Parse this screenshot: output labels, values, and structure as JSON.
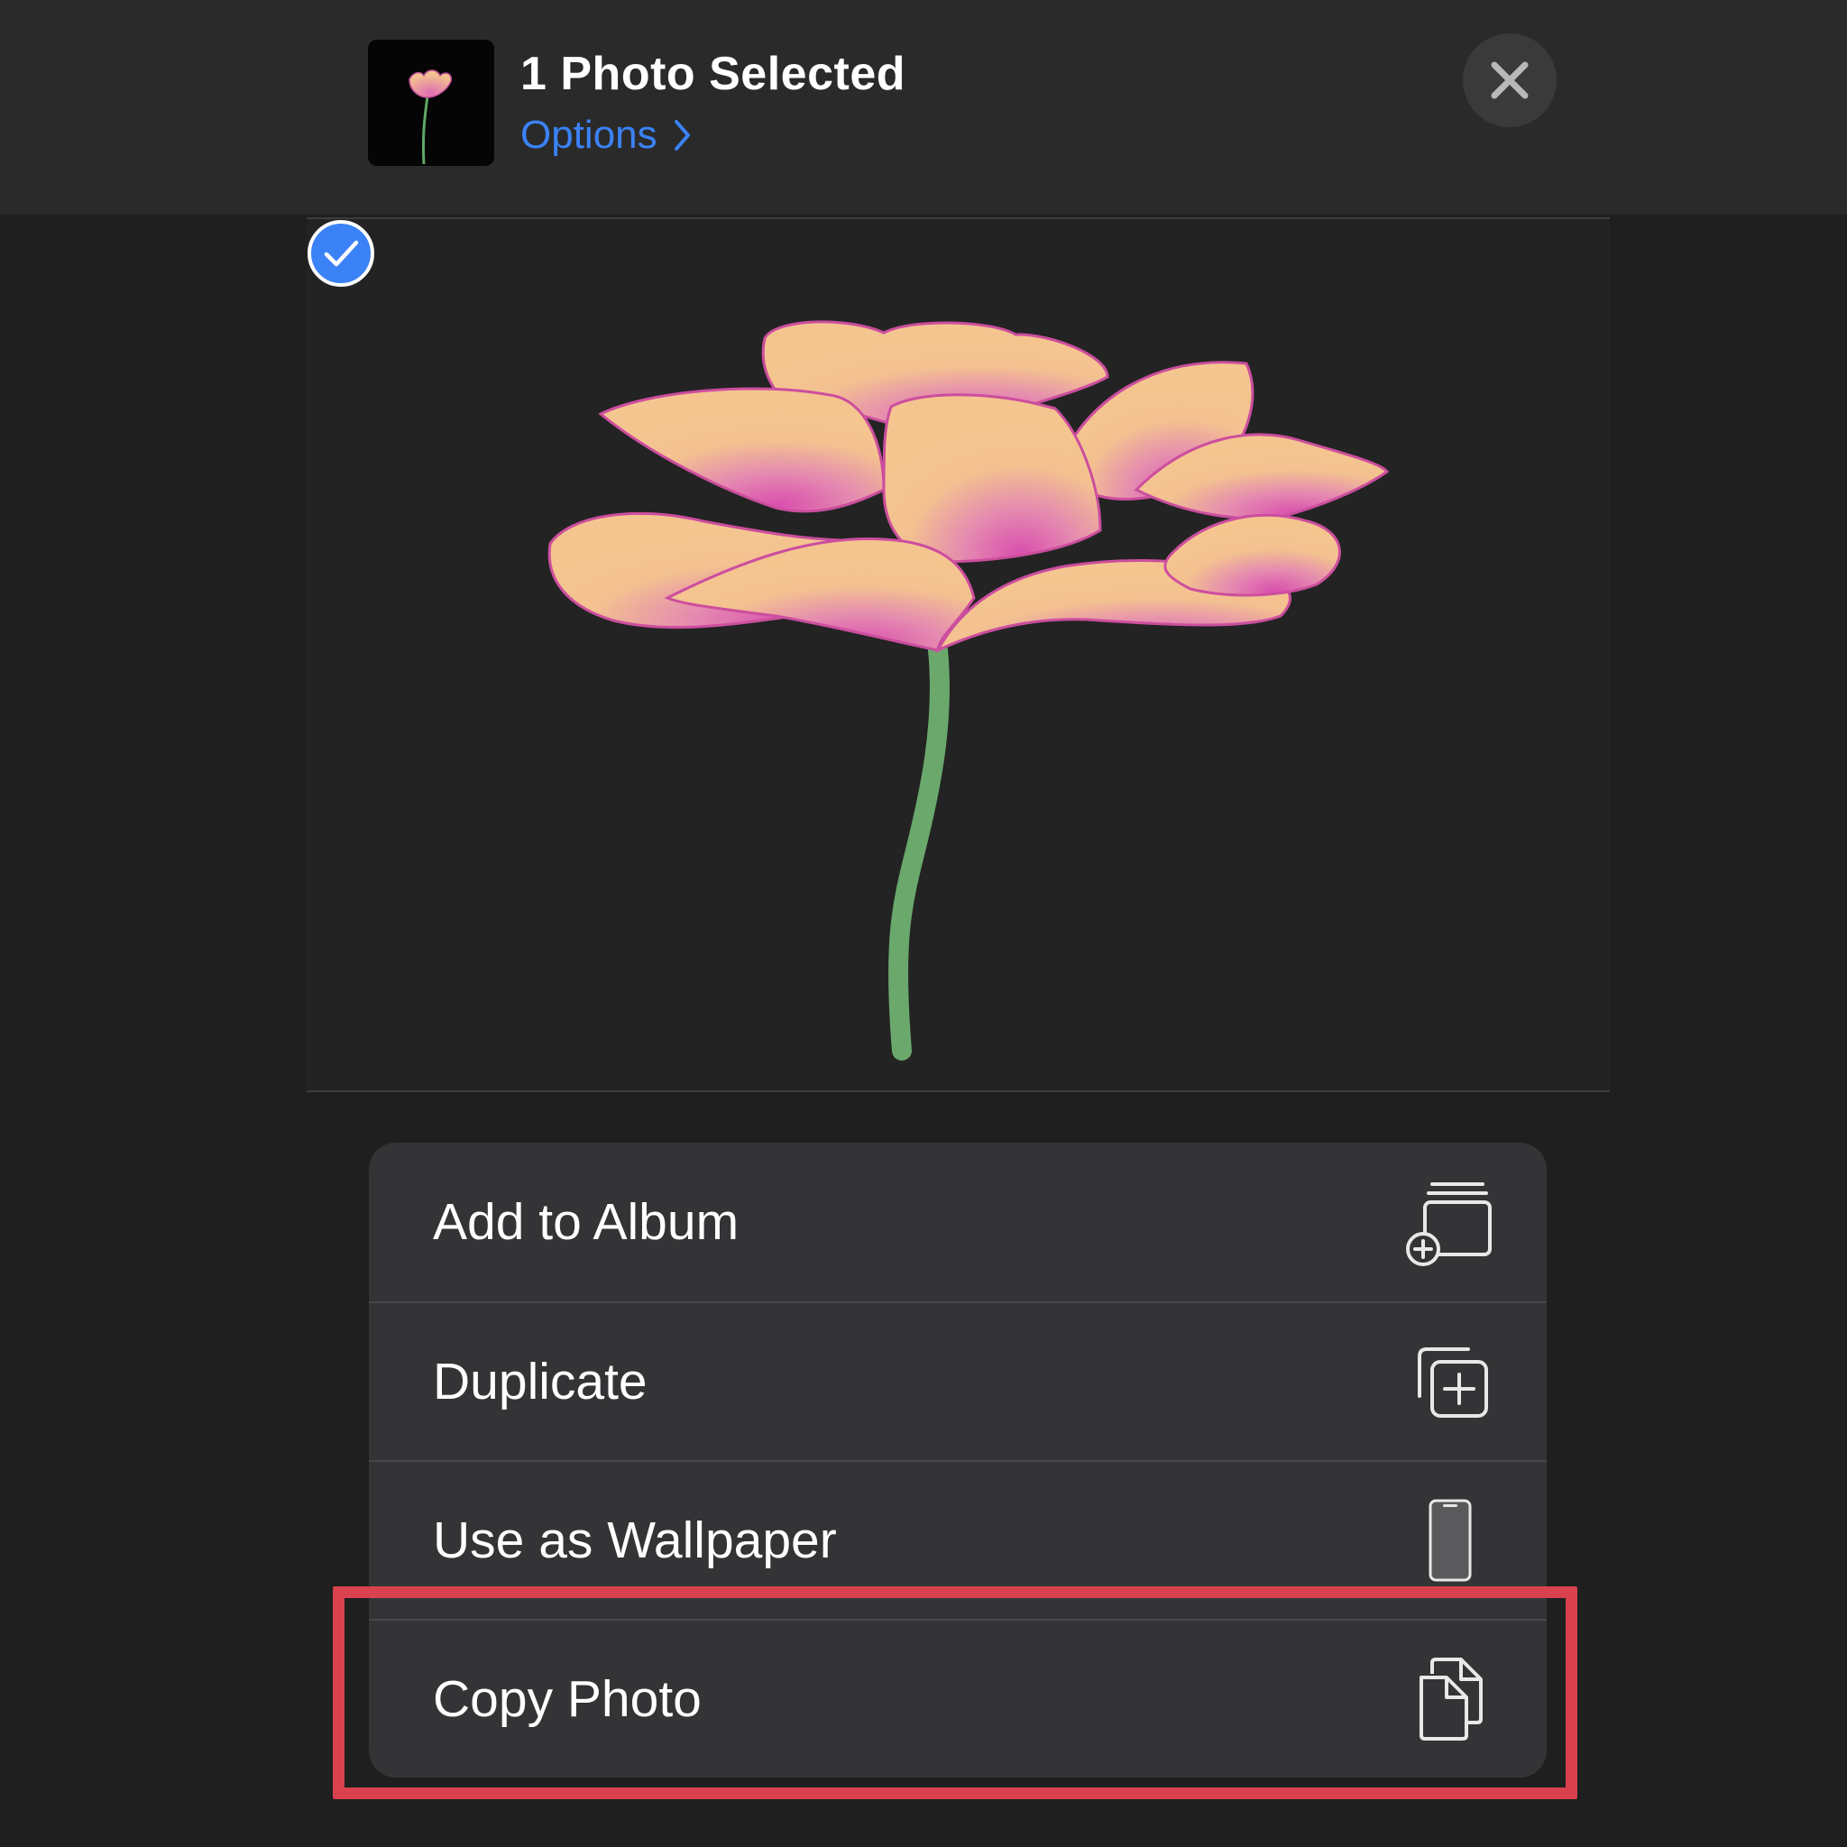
{
  "header": {
    "title": "1 Photo Selected",
    "options_label": "Options",
    "thumbnail_icon": "flower-thumbnail",
    "close_icon": "close-icon"
  },
  "preview": {
    "image_subject": "flower",
    "selected": true,
    "check_icon": "checkmark-circle-icon"
  },
  "menu": {
    "items": [
      {
        "label": "Add to Album",
        "icon": "add-to-album-icon"
      },
      {
        "label": "Duplicate",
        "icon": "duplicate-icon"
      },
      {
        "label": "Use as Wallpaper",
        "icon": "phone-icon"
      },
      {
        "label": "Copy Photo",
        "icon": "copy-icon"
      }
    ]
  },
  "highlight": {
    "target": "Copy Photo",
    "color": "#d9414f"
  },
  "colors": {
    "accent": "#3b82f6",
    "background": "#1f1f1f",
    "header_bg": "#2a2a2a",
    "menu_bg": "#343436"
  }
}
